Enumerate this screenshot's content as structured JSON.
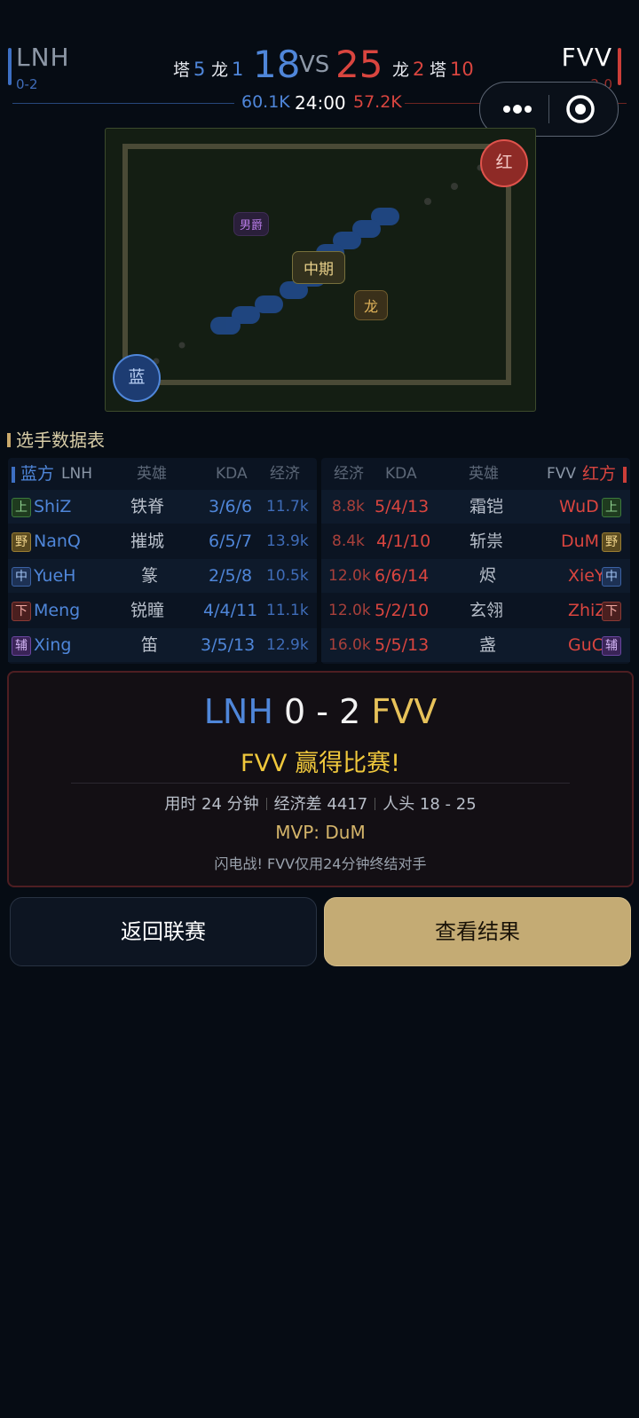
{
  "header": {
    "blue_team": {
      "name": "LNH",
      "record": "0-2",
      "towers_label": "塔",
      "towers": "5",
      "dragons_label": "龙",
      "dragons": "1",
      "kills": "18",
      "gold": "60.1K"
    },
    "red_team": {
      "name": "FVV",
      "record": "2-0",
      "towers_label": "塔",
      "towers": "10",
      "dragons_label": "龙",
      "dragons": "2",
      "kills": "25",
      "gold": "57.2K"
    },
    "vs": "VS",
    "time": "24:00"
  },
  "map": {
    "labels": {
      "baron": "男爵",
      "phase": "中期",
      "dragon": "龙"
    },
    "bases": {
      "red": "红",
      "blue": "蓝"
    }
  },
  "section_title": "选手数据表",
  "blue_table": {
    "side_label": "蓝方",
    "team": "LNH",
    "headers": {
      "hero": "英雄",
      "kda": "KDA",
      "gold": "经济"
    },
    "rows": [
      {
        "role": "上",
        "player": "ShiZ",
        "hero": "铁脊",
        "kda": "3/6/6",
        "gold": "11.7k"
      },
      {
        "role": "野",
        "player": "NanQ",
        "hero": "摧城",
        "kda": "6/5/7",
        "gold": "13.9k"
      },
      {
        "role": "中",
        "player": "YueH",
        "hero": "篆",
        "kda": "2/5/8",
        "gold": "10.5k"
      },
      {
        "role": "下",
        "player": "Meng",
        "hero": "锐瞳",
        "kda": "4/4/11",
        "gold": "11.1k"
      },
      {
        "role": "辅",
        "player": "Xing",
        "hero": "笛",
        "kda": "3/5/13",
        "gold": "12.9k"
      }
    ]
  },
  "red_table": {
    "side_label": "红方",
    "team": "FVV",
    "headers": {
      "hero": "英雄",
      "kda": "KDA",
      "gold": "经济"
    },
    "rows": [
      {
        "role": "上",
        "player": "WuD",
        "hero": "霜铠",
        "kda": "5/4/13",
        "gold": "8.8k"
      },
      {
        "role": "野",
        "player": "DuM",
        "hero": "斩祟",
        "kda": "4/1/10",
        "gold": "8.4k"
      },
      {
        "role": "中",
        "player": "XieY",
        "hero": "烬",
        "kda": "6/6/14",
        "gold": "12.0k"
      },
      {
        "role": "下",
        "player": "ZhiZ",
        "hero": "玄翎",
        "kda": "5/2/10",
        "gold": "12.0k"
      },
      {
        "role": "辅",
        "player": "GuC",
        "hero": "盏",
        "kda": "5/5/13",
        "gold": "16.0k"
      }
    ]
  },
  "result": {
    "left_team": "LNH",
    "score": "0 - 2",
    "right_team": "FVV",
    "winner_text": "FVV 赢得比赛!",
    "duration": "用时 24 分钟",
    "gold_diff": "经济差 4417",
    "kills": "人头 18 - 25",
    "mvp": "MVP: DuM",
    "note": "闪电战! FVV仅用24分钟终结对手"
  },
  "buttons": {
    "back": "返回联赛",
    "view": "查看结果"
  },
  "colors": {
    "blue": "#4f86d9",
    "red": "#d9453f",
    "gold": "#e7c25a",
    "button_gold": "#c4ab74"
  }
}
